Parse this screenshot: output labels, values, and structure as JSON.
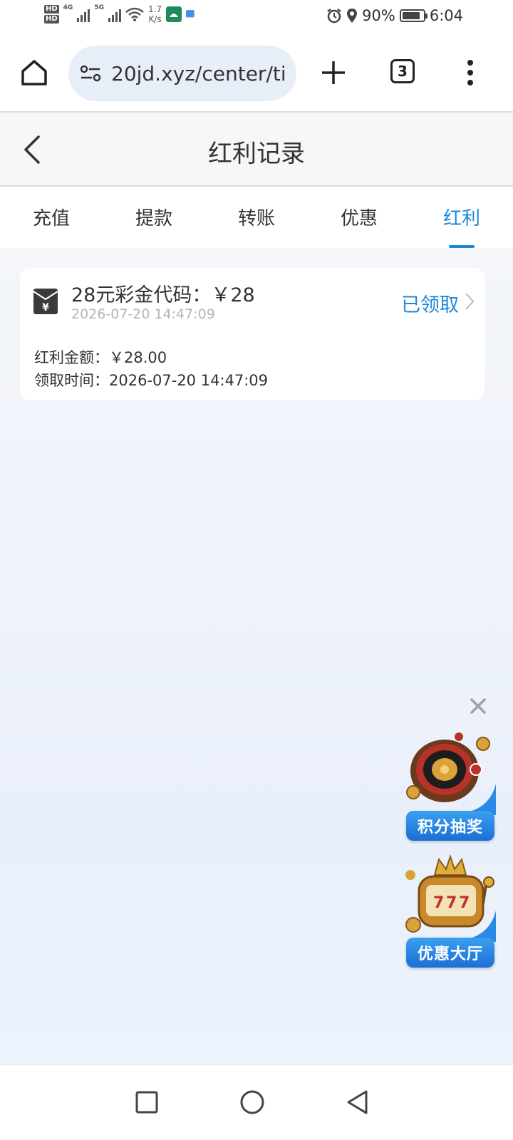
{
  "status_bar": {
    "hd1": "HD",
    "hd2": "HD",
    "net1": "4G",
    "net2": "5G",
    "speed_value": "1.7",
    "speed_unit": "K/s",
    "battery": "90%",
    "time": "6:04"
  },
  "browser": {
    "url": "20jd.xyz/center/ti",
    "tab_count": "3"
  },
  "header": {
    "title": "红利记录"
  },
  "tabs": [
    {
      "label": "充值",
      "active": false
    },
    {
      "label": "提款",
      "active": false
    },
    {
      "label": "转账",
      "active": false
    },
    {
      "label": "优惠",
      "active": false
    },
    {
      "label": "红利",
      "active": true
    }
  ],
  "record": {
    "title": "28元彩金代码：￥28",
    "date": "2026-07-20 14:47:09",
    "status": "已领取",
    "amount_line": "红利金额：￥28.00",
    "claim_time_line": "领取时间：2026-07-20 14:47:09"
  },
  "promos": [
    {
      "label": "积分抽奖",
      "icon": "roulette-icon"
    },
    {
      "label": "优惠大厅",
      "icon": "slot-machine-icon"
    }
  ],
  "colors": {
    "accent": "#1e88d8",
    "promo_blue": "#2a8ae6",
    "gold": "#d9a23a"
  }
}
